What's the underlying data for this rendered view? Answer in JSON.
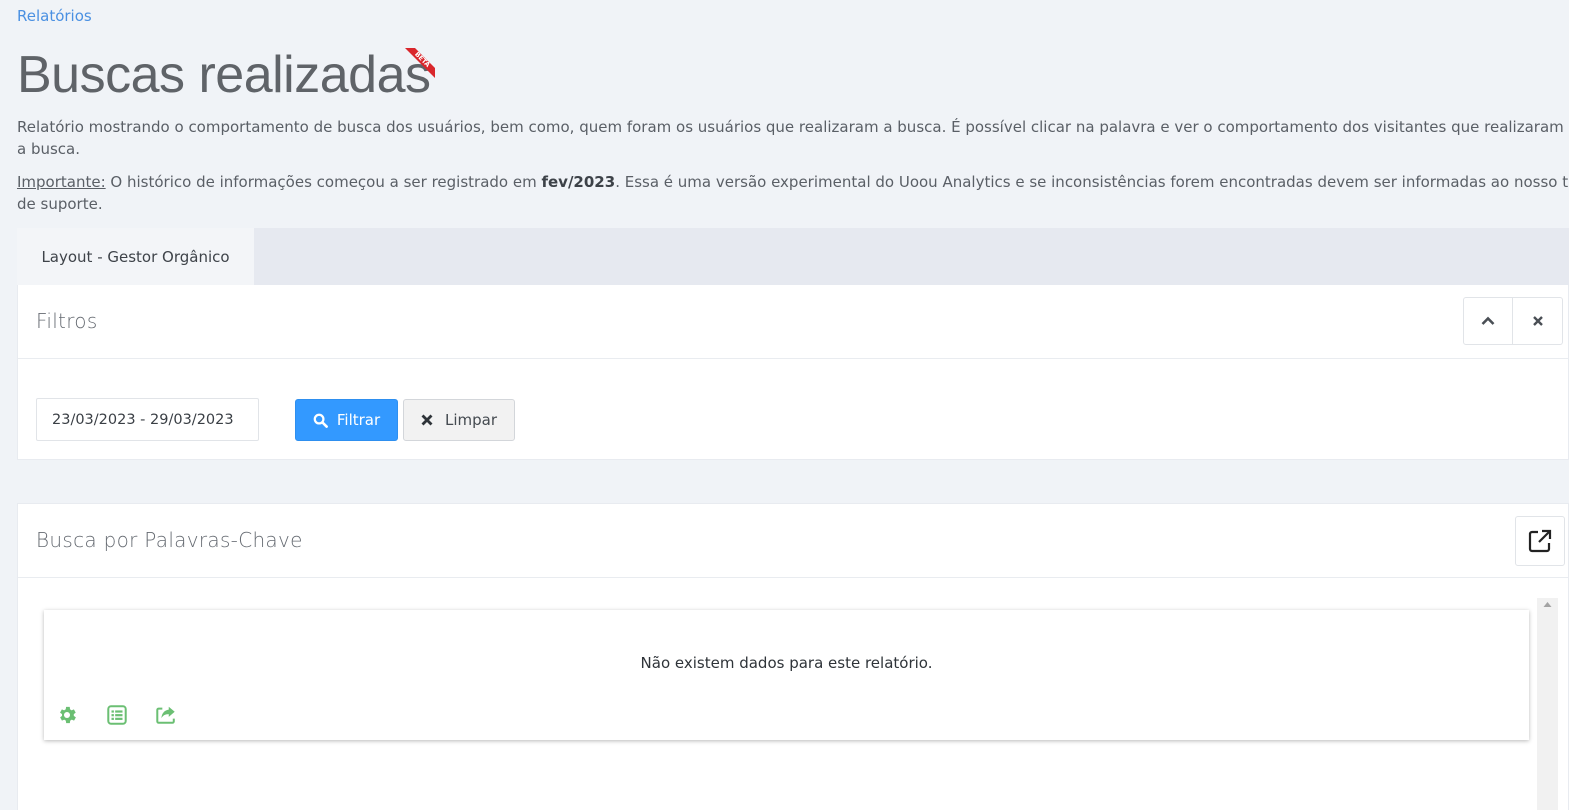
{
  "breadcrumb": {
    "label": "Relatórios"
  },
  "header": {
    "title": "Buscas realizadas",
    "badge": "BETA",
    "description": "Relatório mostrando o comportamento de busca dos usuários, bem como, quem foram os usuários que realizaram a busca. É possível clicar na palavra e ver o comportamento dos visitantes que realizaram a busca.",
    "important_label": "Importante:",
    "important_text_before": " O histórico de informações começou a ser registrado em ",
    "important_date": "fev/2023",
    "important_text_after": ". Essa é uma versão experimental do Uoou Analytics e se inconsistências forem encontradas devem ser informadas ao nosso time",
    "important_line2": "de suporte."
  },
  "tabs": [
    {
      "label": "Layout - Gestor Orgânico",
      "active": true
    }
  ],
  "filters": {
    "title": "Filtros",
    "date_range": "23/03/2023 - 29/03/2023",
    "filter_button": "Filtrar",
    "clear_button": "Limpar"
  },
  "keywords": {
    "title": "Busca por Palavras-Chave",
    "empty_message": "Não existem dados para este relatório."
  },
  "icons": {
    "settings": "gear-icon",
    "table": "list-icon",
    "export": "share-icon",
    "collapse": "chevron-up-icon",
    "close": "close-icon",
    "external": "external-link-icon"
  },
  "colors": {
    "primary": "#3399ff",
    "link": "#4a90e2",
    "accent_green": "#6bbf73",
    "beta_ribbon": "#d9262c"
  }
}
